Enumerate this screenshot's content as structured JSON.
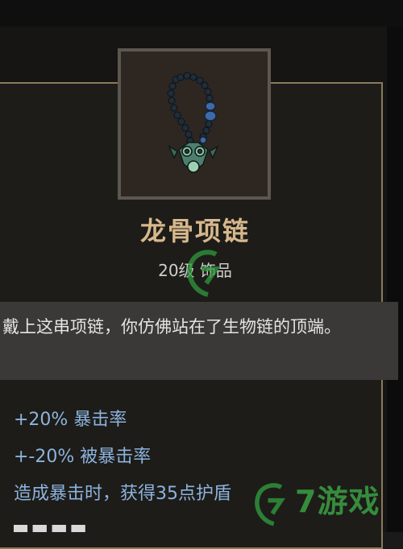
{
  "item": {
    "name": "龙骨项链",
    "meta": "20级 饰品",
    "icon": "necklace-icon",
    "flavor": "戴上这串项链，你仿佛站在了生物链的顶端。"
  },
  "stats": [
    "+20% 暴击率",
    "+-20% 被暴击率",
    "造成暴击时，获得35点护盾"
  ],
  "colors": {
    "name": "#d6b88d",
    "stat": "#8db3df",
    "frame": "#8a7a5c",
    "watermark": "#3aa044"
  },
  "watermark": {
    "text": "7游戏"
  }
}
